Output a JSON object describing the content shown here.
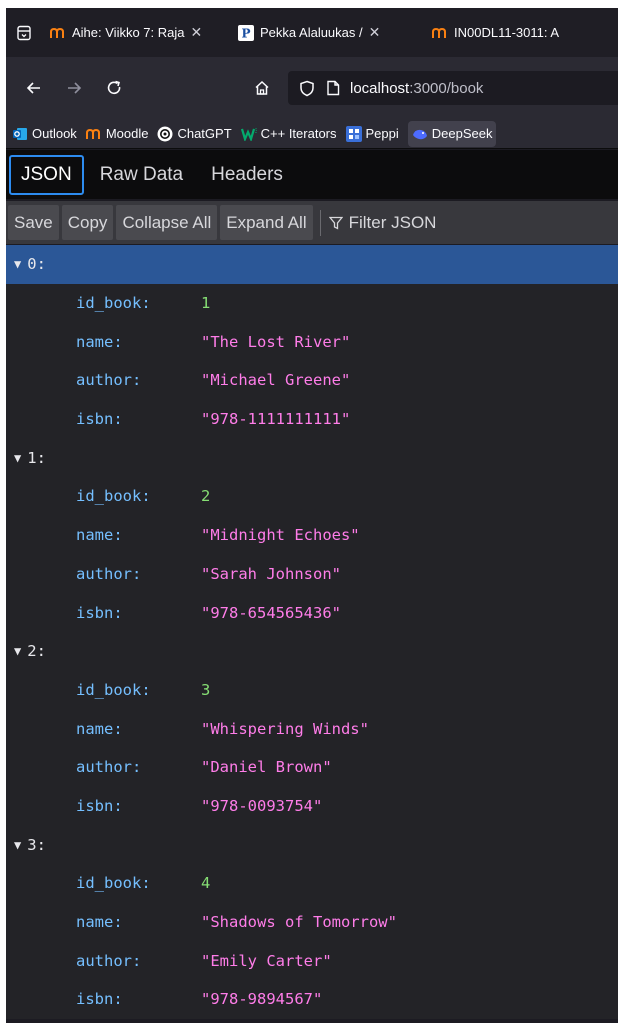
{
  "tabs": [
    {
      "title": "Aihe: Viikko 7: Raja",
      "icon": "moodle-icon"
    },
    {
      "title": "Pekka Alaluukas /",
      "icon": "p-icon"
    },
    {
      "title": "IN00DL11-3011: A",
      "icon": "moodle-icon"
    }
  ],
  "nav": {
    "url_host": "localhost",
    "url_path": ":3000/book"
  },
  "bookmarks": [
    {
      "label": "Outlook",
      "icon": "outlook-icon"
    },
    {
      "label": "Moodle",
      "icon": "moodle-icon"
    },
    {
      "label": "ChatGPT",
      "icon": "chatgpt-icon"
    },
    {
      "label": "C++ Iterators",
      "icon": "w3-icon"
    },
    {
      "label": "Peppi",
      "icon": "peppi-icon"
    },
    {
      "label": "DeepSeek",
      "icon": "deepseek-icon"
    }
  ],
  "viewer": {
    "tabs": [
      "JSON",
      "Raw Data",
      "Headers"
    ],
    "active_tab": "JSON"
  },
  "toolbar": {
    "save": "Save",
    "copy": "Copy",
    "collapse_all": "Collapse All",
    "expand_all": "Expand All",
    "filter": "Filter JSON"
  },
  "books": [
    {
      "index": "0:",
      "rows": [
        {
          "key": "id_book:",
          "value": "1",
          "type": "num"
        },
        {
          "key": "name:",
          "value": "\"The Lost River\"",
          "type": "str"
        },
        {
          "key": "author:",
          "value": "\"Michael Greene\"",
          "type": "str"
        },
        {
          "key": "isbn:",
          "value": "\"978-1111111111\"",
          "type": "str"
        }
      ]
    },
    {
      "index": "1:",
      "rows": [
        {
          "key": "id_book:",
          "value": "2",
          "type": "num"
        },
        {
          "key": "name:",
          "value": "\"Midnight Echoes\"",
          "type": "str"
        },
        {
          "key": "author:",
          "value": "\"Sarah Johnson\"",
          "type": "str"
        },
        {
          "key": "isbn:",
          "value": "\"978-654565436\"",
          "type": "str"
        }
      ]
    },
    {
      "index": "2:",
      "rows": [
        {
          "key": "id_book:",
          "value": "3",
          "type": "num"
        },
        {
          "key": "name:",
          "value": "\"Whispering Winds\"",
          "type": "str"
        },
        {
          "key": "author:",
          "value": "\"Daniel Brown\"",
          "type": "str"
        },
        {
          "key": "isbn:",
          "value": "\"978-0093754\"",
          "type": "str"
        }
      ]
    },
    {
      "index": "3:",
      "rows": [
        {
          "key": "id_book:",
          "value": "4",
          "type": "num"
        },
        {
          "key": "name:",
          "value": "\"Shadows of Tomorrow\"",
          "type": "str"
        },
        {
          "key": "author:",
          "value": "\"Emily Carter\"",
          "type": "str"
        },
        {
          "key": "isbn:",
          "value": "\"978-9894567\"",
          "type": "str"
        }
      ]
    }
  ],
  "colors": {
    "key": "#75bfff",
    "string": "#ff7de9",
    "number": "#86de74",
    "selected_row": "#2b5797"
  }
}
